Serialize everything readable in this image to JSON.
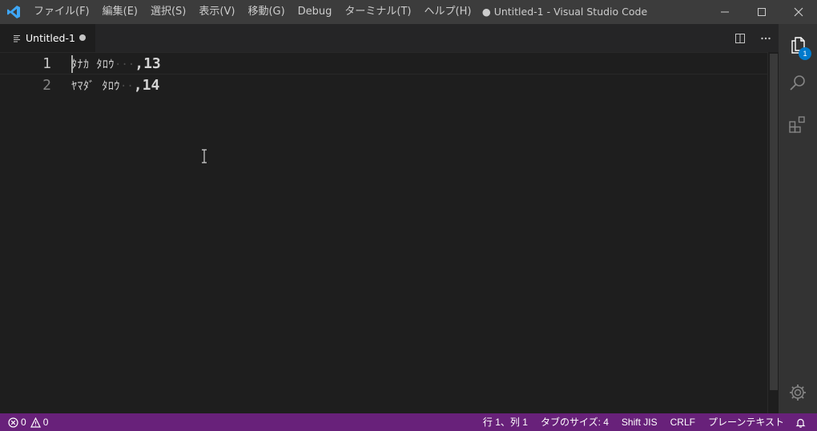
{
  "titlebar": {
    "menu": [
      "ファイル(F)",
      "編集(E)",
      "選択(S)",
      "表示(V)",
      "移動(G)",
      "Debug",
      "ターミナル(T)",
      "ヘルプ(H)"
    ],
    "title": "● Untitled-1 - Visual Studio Code"
  },
  "tabs": [
    {
      "label": "Untitled-1",
      "dirty": true
    }
  ],
  "editor": {
    "lines": [
      {
        "number": "1",
        "kana": "ﾀﾅｶ ﾀﾛｳ",
        "trailing": ",13"
      },
      {
        "number": "2",
        "kana": "ﾔﾏﾀﾞ ﾀﾛｳ",
        "trailing": ",14"
      }
    ]
  },
  "activitybar": {
    "explorer_badge": "1"
  },
  "statusbar": {
    "errors": "0",
    "warnings": "0",
    "position": "行 1、列 1",
    "tab_size": "タブのサイズ: 4",
    "encoding": "Shift JIS",
    "eol": "CRLF",
    "language": "プレーンテキスト"
  },
  "colors": {
    "statusbar": "#68217a",
    "titlebar": "#3c3c3c",
    "editor_bg": "#1e1e1e",
    "accent": "#007acc",
    "logo": "#3ea6f5"
  }
}
